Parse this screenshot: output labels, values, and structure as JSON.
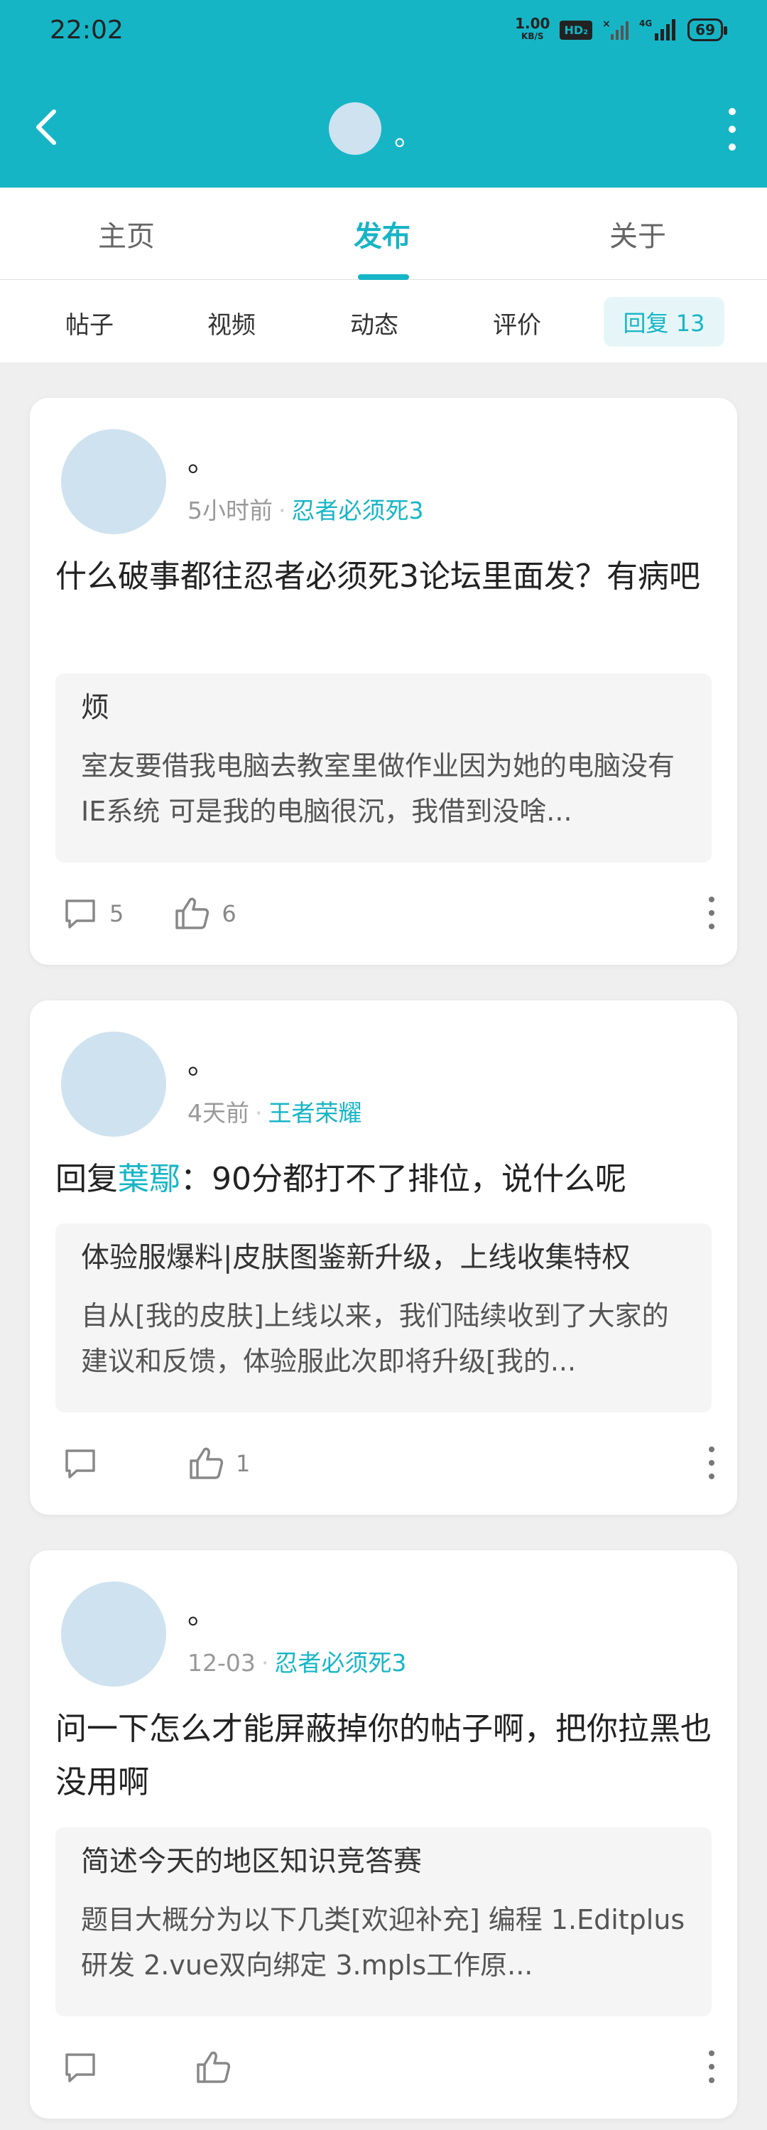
{
  "status_bar": {
    "time": "22:02",
    "speed_value": "1.00",
    "speed_unit": "KB/S",
    "hd_label": "HD₂",
    "battery": "69"
  },
  "header": {
    "user_name": "。"
  },
  "tabs": [
    {
      "label": "主页"
    },
    {
      "label": "发布"
    },
    {
      "label": "关于"
    }
  ],
  "subtabs": [
    {
      "label": "帖子"
    },
    {
      "label": "视频"
    },
    {
      "label": "动态"
    },
    {
      "label": "评价"
    },
    {
      "label": "回复 13"
    }
  ],
  "posts": [
    {
      "name": "。",
      "time": "5小时前",
      "forum": "忍者必须死3",
      "title": "什么破事都往忍者必须死3论坛里面发？有病吧",
      "quote_title": "烦",
      "quote_body": "室友要借我电脑去教室里做作业因为她的电脑没有IE系统 可是我的电脑很沉，我借到没啥...",
      "comments": "5",
      "likes": "6"
    },
    {
      "name": "。",
      "time": "4天前",
      "forum": "王者荣耀",
      "title_prefix": "回复",
      "reply_to": "葉鄢",
      "title": "：90分都打不了排位，说什么呢",
      "quote_title": "体验服爆料|皮肤图鉴新升级，上线收集特权",
      "quote_body": "自从[我的皮肤]上线以来，我们陆续收到了大家的建议和反馈，体验服此次即将升级[我的...",
      "comments": "",
      "likes": "1"
    },
    {
      "name": "。",
      "time": "12-03",
      "forum": "忍者必须死3",
      "title": "问一下怎么才能屏蔽掉你的帖子啊，把你拉黑也没用啊",
      "quote_title": "简述今天的地区知识竞答赛",
      "quote_body": "题目大概分为以下几类[欢迎补充] 编程 1.Editplus研发 2.vue双向绑定 3.mpls工作原...",
      "comments": "",
      "likes": ""
    }
  ]
}
